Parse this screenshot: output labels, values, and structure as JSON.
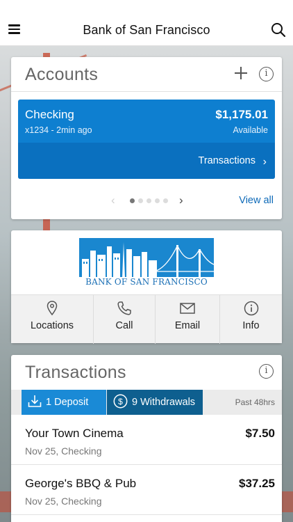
{
  "header": {
    "title": "Bank of San Francisco"
  },
  "accounts": {
    "title": "Accounts",
    "account": {
      "name": "Checking",
      "number_and_updated": "x1234 - 2min ago",
      "balance": "$1,175.01",
      "balance_label": "Available",
      "transactions_link": "Transactions"
    },
    "pager": {
      "pages": 5,
      "current": 1
    },
    "view_all": "View all"
  },
  "bank": {
    "logo_text": "BANK OF SAN FRANCISCO",
    "actions": [
      {
        "label": "Locations",
        "icon": "location-pin-icon"
      },
      {
        "label": "Call",
        "icon": "phone-icon"
      },
      {
        "label": "Email",
        "icon": "mail-icon"
      },
      {
        "label": "Info",
        "icon": "info-icon"
      }
    ]
  },
  "transactions": {
    "title": "Transactions",
    "tabs": [
      {
        "label": "1 Deposit",
        "icon": "download-icon"
      },
      {
        "label": "9 Withdrawals",
        "icon": "dollar-circle-icon"
      }
    ],
    "period": "Past 48hrs",
    "items": [
      {
        "name": "Your Town Cinema",
        "amount": "$7.50",
        "meta": "Nov 25, Checking"
      },
      {
        "name": "George's BBQ & Pub",
        "amount": "$37.25",
        "meta": "Nov 25, Checking"
      }
    ]
  },
  "colors": {
    "accent": "#0e7fd0",
    "tab_deposit": "#1a8ad6",
    "tab_withdraw": "#0e5f8f",
    "link": "#0e6ab8"
  }
}
